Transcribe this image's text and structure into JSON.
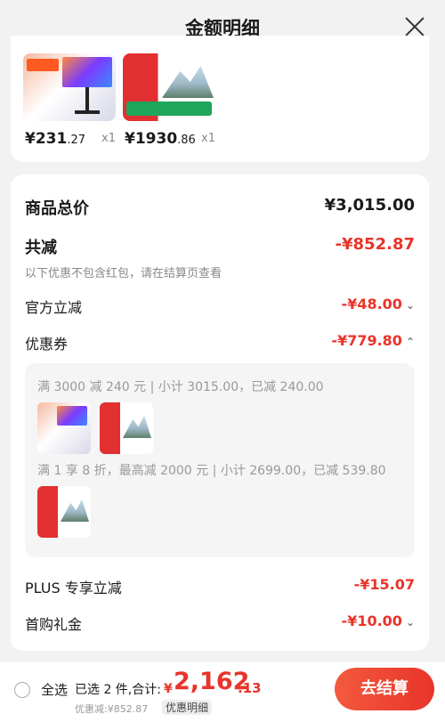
{
  "header": {
    "title": "金额明细"
  },
  "products": [
    {
      "price_main": "¥231",
      "price_dec": ".27",
      "qty": "x1"
    },
    {
      "price_main": "¥1930",
      "price_dec": ".86",
      "qty": "x1"
    }
  ],
  "detail": {
    "total_label": "商品总价",
    "total_value": "¥3,015.00",
    "reduce_label": "共减",
    "reduce_value": "-¥852.87",
    "reduce_note": "以下优惠不包含红包，请在结算页查看",
    "official_label": "官方立减",
    "official_value": "-¥48.00",
    "coupon_label": "优惠券",
    "coupon_value": "-¥779.80",
    "coupons": [
      "满 3000 减 240 元 | 小计 3015.00，已减 240.00",
      "满 1 享 8 折，最高减 2000 元 | 小计 2699.00，已减 539.80"
    ],
    "plus_label": "PLUS 专享立减",
    "plus_value": "-¥15.07",
    "first_label": "首购礼金",
    "first_value": "-¥10.00"
  },
  "bottom": {
    "select_all": "全选",
    "summary": "已选 2 件,合计:",
    "currency": "¥",
    "total_int": "2,162",
    "total_dec": ".13",
    "discount": "优惠减:¥852.87",
    "detail_link": "优惠明细",
    "checkout": "去结算"
  },
  "colors": {
    "accent": "#e8342a",
    "bg": "#f2f2f2"
  }
}
